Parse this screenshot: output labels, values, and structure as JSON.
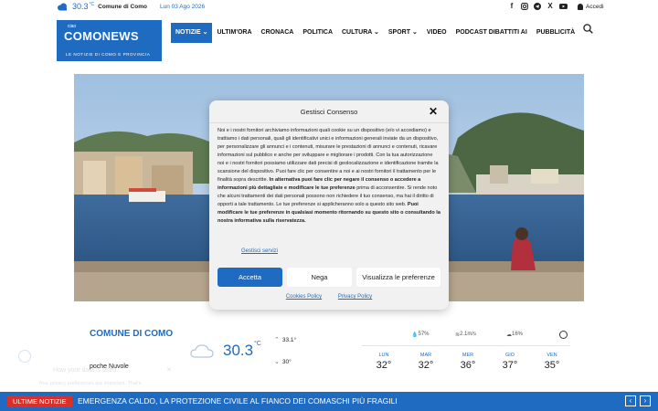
{
  "topbar": {
    "weather_temp": "30.3",
    "weather_unit": "°C",
    "weather_city": "Comune di Como",
    "date": "Lun 03 Ago 2026",
    "social_icons": [
      "facebook-icon",
      "instagram-icon",
      "telegram-icon",
      "x-icon",
      "youtube-icon"
    ],
    "login_label": "Accedi"
  },
  "logo": {
    "small": "ciao",
    "name": "COMONEWS",
    "tagline": "LE NOTIZIE DI COMO E PROVINCIA"
  },
  "nav": {
    "items": [
      {
        "label": "NOTIZIE",
        "dropdown": true,
        "active": true
      },
      {
        "label": "ULTIM'ORA",
        "dropdown": false
      },
      {
        "label": "CRONACA",
        "dropdown": false
      },
      {
        "label": "POLITICA",
        "dropdown": false
      },
      {
        "label": "CULTURA",
        "dropdown": true
      },
      {
        "label": "SPORT",
        "dropdown": true
      },
      {
        "label": "VIDEO",
        "dropdown": false
      },
      {
        "label": "PODCAST DIBATTITI AI",
        "dropdown": false
      },
      {
        "label": "PUBBLICITÀ",
        "dropdown": false
      }
    ],
    "dropdown_glyph": "⌄"
  },
  "weather_widget": {
    "title": "COMUNE DI COMO",
    "condition": "poche Nuvole",
    "temp": "30.3",
    "unit": "°C",
    "high": "33.1°",
    "low": "30°",
    "humidity": "57%",
    "wind": "2.1m/s",
    "clouds": "16%",
    "days": [
      {
        "day": "LUN",
        "temp": "32°"
      },
      {
        "day": "MAR",
        "temp": "32°"
      },
      {
        "day": "MER",
        "temp": "36°"
      },
      {
        "day": "GIO",
        "temp": "37°"
      },
      {
        "day": "VEN",
        "temp": "35°"
      }
    ]
  },
  "faded_cookie": {
    "title": "How your data is used",
    "body": "Your privacy preferences are important. That's"
  },
  "ticker": {
    "tag": "ULTIME NOTIZIE",
    "headline": "EMERGENZA CALDO, LA PROTEZIONE CIVILE AL FIANCO DEI COMASCHI PIÙ FRAGILI",
    "prev": "‹",
    "next": "›"
  },
  "consent_modal": {
    "title": "Gestisci Consenso",
    "close": "✕",
    "body_part1": "Noi e i nostri fornitori archiviamo informazioni quali cookie su un dispositivo (e/o vi accediamo) e trattiamo i dati personali, quali gli identificativi unici e informazioni generali inviate da un dispositivo, per personalizzare gli annunci e i contenuti, misurare le prestazioni di annunci e contenuti, ricavare informazioni sul pubblico e anche per sviluppare e migliorare i prodotti. Con la tua autorizzazione noi e i nostri fornitori possiamo utilizzare dati precisi di geolocalizzazione e identificazione tramite la scansione del dispositivo. Puoi fare clic per consentire a noi e ai nostri fornitori il trattamento per le finalità sopra descritte.",
    "body_bold1": " In alternativa puoi fare clic per negare il consenso o accedere a informazioni più dettagliate e modificare le tue preferenze",
    "body_part2": " prima di acconsentire. Si rende noto che alcuni trattamenti dei dati personali possono non richiedere il tuo consenso, ma hai il diritto di opporti a tale trattamento. Le tue preferenze si applicheranno solo a questo sito web.",
    "body_bold2": " Puoi modificare le tue preferenze in qualsiasi momento ritornando su questo sito o consultando la nostra informativa sulla riservatezza.",
    "manage_services": "Gestisci servizi",
    "accept": "Accetta",
    "deny": "Nega",
    "preferences": "Visualizza le preferenze",
    "cookie_policy": "Cookies Policy",
    "privacy_policy": "Privacy Policy"
  },
  "colors": {
    "brand": "#1e6bc1",
    "ticker_tag": "#d9302a"
  }
}
